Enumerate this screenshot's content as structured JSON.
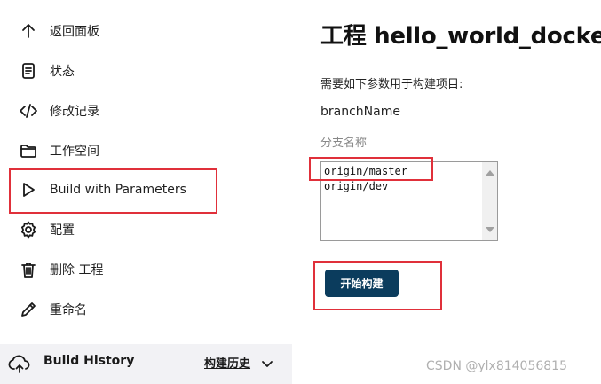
{
  "sidebar": {
    "items": [
      {
        "label": "返回面板",
        "icon": "arrow-up-icon"
      },
      {
        "label": "状态",
        "icon": "document-icon"
      },
      {
        "label": "修改记录",
        "icon": "code-icon"
      },
      {
        "label": "工作空间",
        "icon": "folder-icon"
      },
      {
        "label": "Build with Parameters",
        "icon": "play-icon"
      },
      {
        "label": "配置",
        "icon": "gear-icon"
      },
      {
        "label": "删除 工程",
        "icon": "trash-icon"
      },
      {
        "label": "重命名",
        "icon": "pencil-icon"
      }
    ],
    "build_history": {
      "label": "Build History",
      "link": "构建历史",
      "icon": "cloud-icon"
    }
  },
  "main": {
    "title": "工程 hello_world_docker",
    "description": "需要如下参数用于构建项目:",
    "parameter": {
      "name": "branchName",
      "description": "分支名称",
      "options": [
        "origin/master",
        "origin/dev"
      ]
    },
    "build_button": "开始构建"
  },
  "watermark": "CSDN @ylx814056815",
  "colors": {
    "highlight_box": "#e0303a",
    "button": "#0b3c5d",
    "history_bar": "#f2f2f5"
  }
}
